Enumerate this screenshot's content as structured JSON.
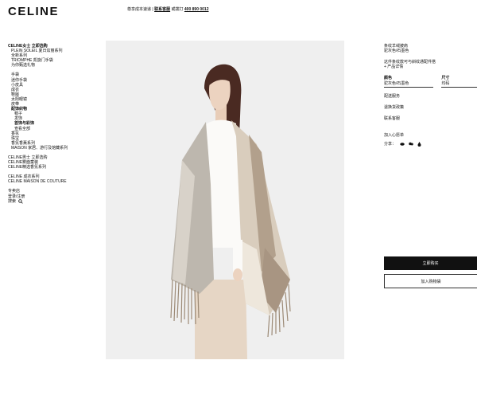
{
  "header": {
    "logo": "CELINE",
    "notice_prefix": "尊享成本速递 |",
    "notice_link": "联系客服",
    "notice_suffix": "或拨打",
    "phone": "400 890 0012"
  },
  "nav": {
    "heading": "CELINE女士 立即选购",
    "group1": [
      "PLEIN SOLEIL 夏日炫丽系列",
      "全新系列",
      "TRIOMPHE 凯旋门手袋",
      "为你甄选礼物"
    ],
    "group2": [
      "手袋",
      "迷你手袋",
      "小皮具",
      "成衣",
      "鞋履",
      "太阳眼镜",
      "皮带"
    ],
    "accessories_heading": "配饰织物",
    "accessories": [
      "帽子",
      "发饰"
    ],
    "jewelry_heading": "首饰与彩饰",
    "jewelry_all": "查看全部",
    "group3": [
      "香氛",
      "珠宝",
      "香氛香薰系列",
      "MAISON 家居、游行及馆藏系列"
    ],
    "group4": [
      "CELINE男士 立即选购",
      "CELINE雾面童装",
      "CELINE精选香氛系列"
    ],
    "group5": [
      "CELINE 成衣系列",
      "CELINE MAISON DE COUTURE"
    ],
    "group6": [
      "专卖店",
      "登录/注册"
    ],
    "search_label": "搜索"
  },
  "product": {
    "title_line1": "条纹羊绒披肩",
    "title_line2": "驼灰色/石墨色",
    "desc_line1": "这件条纹款可与斜纹通配件搭",
    "desc_line2": "+ 产品详情",
    "color_label": "颜色",
    "color_value": "驼灰色/石墨色",
    "size_label": "尺寸",
    "size_value": "均码",
    "links": [
      "配送服务",
      "退换货政策",
      "联系客服"
    ],
    "wishlist": "加入心愿单",
    "share_label": "分享：",
    "buy_label": "立即购买",
    "cart_label": "加入购物袋"
  },
  "colors": {
    "accent": "#111111",
    "image_bg": "#efefef"
  }
}
